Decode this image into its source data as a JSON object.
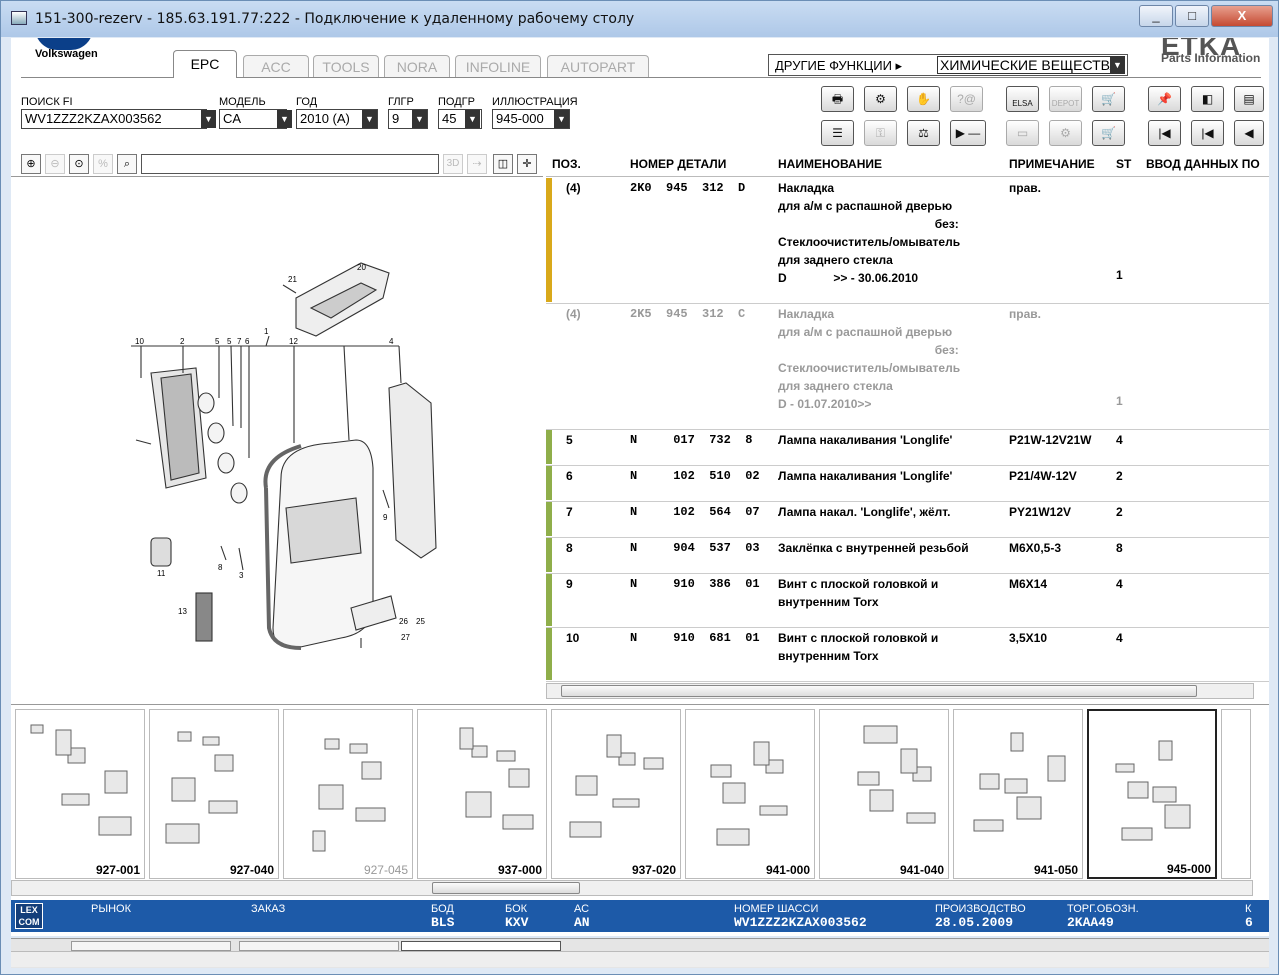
{
  "window": {
    "title": "151-300-rezerv - 185.63.191.77:222 - Подключение к удаленному рабочему столу",
    "min": "_",
    "max": "□",
    "close": "X"
  },
  "brand": {
    "name": "Volkswagen",
    "etka": "ETKA",
    "etka_sub": "Parts Information"
  },
  "tabs": [
    {
      "label": "EPC",
      "active": true
    },
    {
      "label": "ACC"
    },
    {
      "label": "TOOLS"
    },
    {
      "label": "NORA"
    },
    {
      "label": "INFOLINE"
    },
    {
      "label": "AUTOPART"
    }
  ],
  "other_functions": {
    "label": "ДРУГИЕ ФУНКЦИИ ▸",
    "value": "ХИМИЧЕСКИЕ ВЕЩЕСТВА"
  },
  "filters": {
    "search_label": "ПОИСК FI",
    "search_value": "WV1ZZZ2KZAX003562",
    "model_label": "МОДЕЛЬ",
    "model_value": "CA",
    "year_label": "ГОД",
    "year_value": "2010 (A)",
    "mg_label": "ГЛГР",
    "mg_value": "9",
    "sg_label": "ПОДГР",
    "sg_value": "45",
    "ill_label": "ИЛЛЮСТРАЦИЯ",
    "ill_value": "945-000"
  },
  "toolbar": {
    "elsa": "ELSA",
    "depot": "DEPOT"
  },
  "columns": {
    "pos": "ПОЗ.",
    "part": "НОМЕР ДЕТАЛИ",
    "name": "НАИМЕНОВАНИЕ",
    "note": "ПРИМЕЧАНИЕ",
    "st": "ST",
    "input": "ВВОД ДАННЫХ ПО"
  },
  "rows": [
    {
      "pos": "(4)",
      "part": "2K0  945  312  D",
      "name": "Накладка\nдля а/м с распашной дверью\n                                               без:\nСтеклоочиститель/омыватель\nдля заднего стекла\nD              >> - 30.06.2010",
      "note": "прав.",
      "st": "1",
      "bar": "#d9a91a",
      "grey": false
    },
    {
      "pos": "(4)",
      "part": "2K5  945  312  C",
      "name": "Накладка\nдля а/м с распашной дверью\n                                               без:\nСтеклоочиститель/омыватель\nдля заднего стекла\nD - 01.07.2010>>",
      "note": "прав.",
      "st": "1",
      "bar": "",
      "grey": true
    },
    {
      "pos": "5",
      "part": "N     017  732  8",
      "name": "Лампа накаливания 'Longlife'",
      "note": "P21W-12V21W",
      "st": "4",
      "bar": "#8fae4a",
      "grey": false
    },
    {
      "pos": "6",
      "part": "N     102  510  02",
      "name": "Лампа накаливания 'Longlife'",
      "note": "P21/4W-12V",
      "st": "2",
      "bar": "#8fae4a",
      "grey": false
    },
    {
      "pos": "7",
      "part": "N     102  564  07",
      "name": "Лампа накал. 'Longlife', жёлт.",
      "note": "PY21W12V",
      "st": "2",
      "bar": "#8fae4a",
      "grey": false
    },
    {
      "pos": "8",
      "part": "N     904  537  03",
      "name": "Заклёпка с внутренней резьбой",
      "note": "M6X0,5-3",
      "st": "8",
      "bar": "#8fae4a",
      "grey": false
    },
    {
      "pos": "9",
      "part": "N     910  386  01",
      "name": "Винт с плоской головкой и\nвнутренним Torx",
      "note": "M6X14",
      "st": "4",
      "bar": "#8fae4a",
      "grey": false
    },
    {
      "pos": "10",
      "part": "N     910  681  01",
      "name": "Винт с плоской головкой и\nвнутренним Torx",
      "note": "3,5X10",
      "st": "4",
      "bar": "#8fae4a",
      "grey": false
    }
  ],
  "diagram": {
    "callouts": [
      "21",
      "20",
      "1",
      "10",
      "2",
      "5",
      "5",
      "7",
      "6",
      "12",
      "4",
      "9",
      "8",
      "3",
      "11",
      "13",
      "26",
      "25",
      "27"
    ]
  },
  "thumbnails": [
    {
      "label": "927-001"
    },
    {
      "label": "927-040"
    },
    {
      "label": "927-045",
      "dim": true
    },
    {
      "label": "937-000"
    },
    {
      "label": "937-020"
    },
    {
      "label": "941-000"
    },
    {
      "label": "941-040"
    },
    {
      "label": "941-050"
    },
    {
      "label": "945-000",
      "selected": true
    }
  ],
  "status": {
    "logo": "LEX\nCOM",
    "market_label": "РЫНОК",
    "order_label": "ЗАКАЗ",
    "bod_label": "БОД",
    "bod_value": "BLS",
    "bok_label": "БОК",
    "bok_value": "KXV",
    "ac_label": "АС",
    "ac_value": "AN",
    "chassis_label": "НОМЕР ШАССИ",
    "chassis_value": "WV1ZZZ2KZAX003562",
    "prod_label": "ПРОИЗВОДСТВО",
    "prod_value": "28.05.2009",
    "trade_label": "ТОРГ.ОБОЗН.",
    "trade_value": "2KAA49",
    "k_label": "К",
    "k_value": "6"
  }
}
